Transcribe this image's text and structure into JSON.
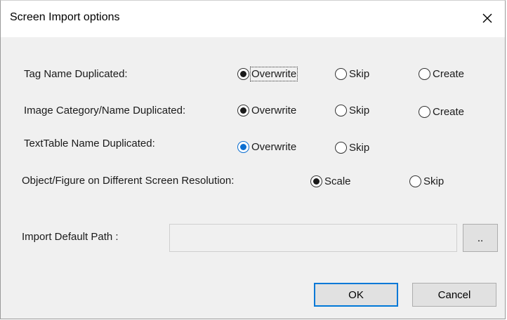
{
  "dialog": {
    "title": "Screen Import options"
  },
  "options": {
    "tag_name": {
      "label": "Tag Name Duplicated:",
      "overwrite": "Overwrite",
      "skip": "Skip",
      "create": "Create",
      "selected": "Overwrite"
    },
    "image_category": {
      "label": "Image Category/Name Duplicated:",
      "overwrite": "Overwrite",
      "skip": "Skip",
      "create": "Create",
      "selected": "Overwrite"
    },
    "texttable": {
      "label": "TextTable Name Duplicated:",
      "overwrite": "Overwrite",
      "skip": "Skip",
      "selected": "Overwrite"
    },
    "resolution": {
      "label": "Object/Figure on Different Screen Resolution:",
      "scale": "Scale",
      "skip": "Skip",
      "selected": "Scale"
    }
  },
  "import_path": {
    "label": "Import Default Path :",
    "value": "",
    "browse_label": ".."
  },
  "buttons": {
    "ok": "OK",
    "cancel": "Cancel"
  },
  "colors": {
    "accent": "#0078d7",
    "selected_radio_blue": "#0a6ed1"
  },
  "icons": {
    "close": "close-icon"
  }
}
